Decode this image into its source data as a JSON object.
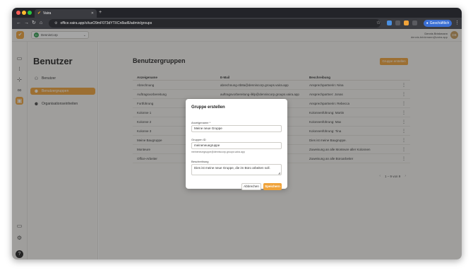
{
  "browser": {
    "tab_title": "Vaira",
    "tab_favicon": "vaira-check-icon",
    "url": "office.vaira.app/o/iuxO9mF073dYTXCn8ad6/admin/groups",
    "profile_label": "Geschäftlich"
  },
  "header": {
    "org_initial": "D",
    "org_name": "DennisCorp",
    "user_name": "Dennis Brinkmann",
    "user_email": "dennis.brinkmann@vaira.app",
    "user_initials": "DB"
  },
  "sidebar": {
    "title": "Benutzer",
    "items": [
      {
        "label": "Benutzer",
        "icon": "person-icon"
      },
      {
        "label": "Benutzergruppen",
        "icon": "group-icon"
      },
      {
        "label": "Organisationseinheiten",
        "icon": "org-units-icon"
      }
    ]
  },
  "main": {
    "title": "Benutzergruppen",
    "create_button": "Gruppe erstellen",
    "columns": [
      "Anzeigename",
      "E-Mail",
      "Beschreibung"
    ],
    "rows": [
      {
        "name": "Abrechnung",
        "email": "abrechnung-4b8a@denniscorp.groups.vaira.app",
        "desc": "Ansprechpartnerin: Nina"
      },
      {
        "name": "Auftragsvorbereitung",
        "email": "auftragsvorbereitung-ilklp@denniscorp.groups.vaira.app",
        "desc": "Ansprechpartner: Jonas"
      },
      {
        "name": "Fortführung",
        "email": "fortfuhrung-8lbs@denniscorp.groups.vaira.app",
        "desc": "Ansprechpartnerin: Rebecca"
      },
      {
        "name": "Kolonne 1",
        "email": "",
        "desc": "Kolonnenführung: Martin"
      },
      {
        "name": "Kolonne 2",
        "email": "",
        "desc": "Kolonnenführung: Max"
      },
      {
        "name": "Kolonne 3",
        "email": "",
        "desc": "Kolonnenführung: Tina"
      },
      {
        "name": "Meine Baugruppe",
        "email": "",
        "desc": "Dies ist meine Baugruppe."
      },
      {
        "name": "Monteure",
        "email": "",
        "desc": "Zuweisung an alle Monteure aller Kolonnen"
      },
      {
        "name": "Office-Arbeiter",
        "email": "",
        "desc": "Zuweisung an alle Büroarbeiter"
      }
    ],
    "pagination": "1 – 9 von 9"
  },
  "modal": {
    "title": "Gruppe erstellen",
    "name_label": "Anzeigename *",
    "name_value": "Meine neue Gruppe",
    "id_label": "Gruppen ID",
    "id_value": "meineneuegruppe",
    "id_help": "meineneuegruppe@denniscorp.groups.vaira.app",
    "desc_label": "Beschreibung",
    "desc_value": "Dies ist meine neue Gruppe, die im Büro arbeiten soll.",
    "cancel_label": "Abbrechen",
    "save_label": "Speichern"
  },
  "colors": {
    "accent": "#f0a33a",
    "background": "#f4f3f0"
  }
}
